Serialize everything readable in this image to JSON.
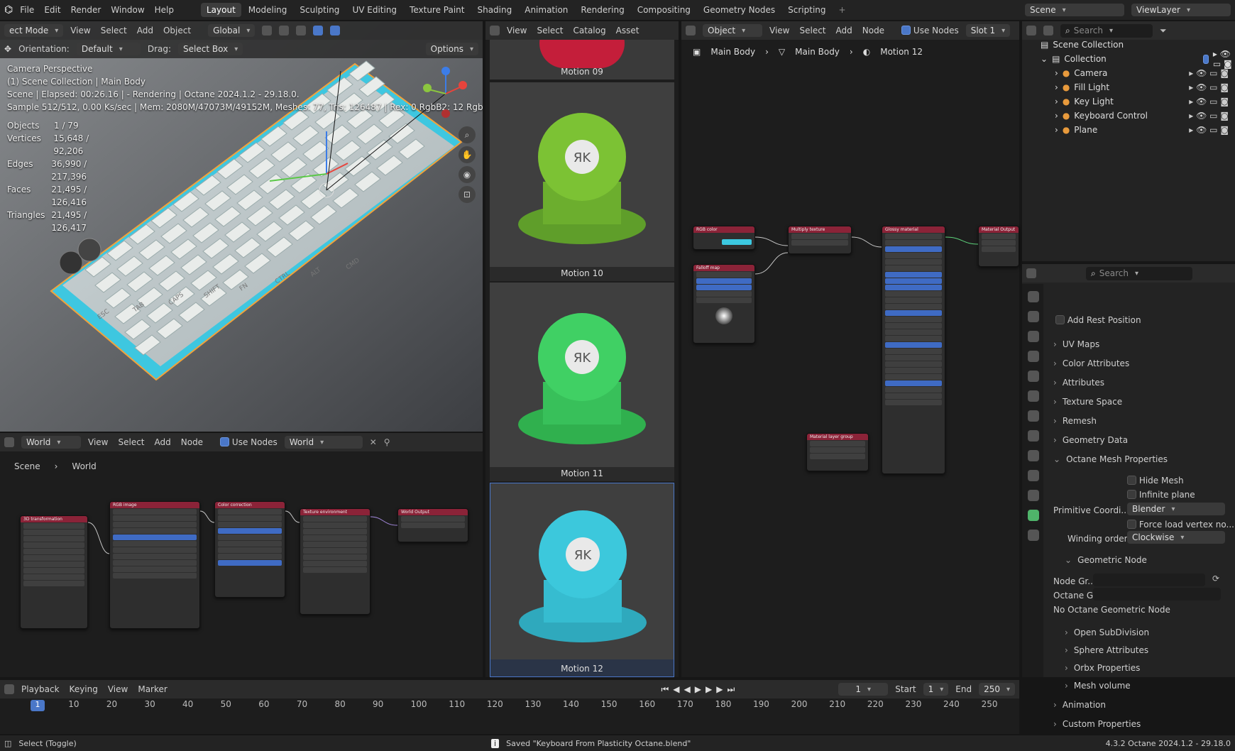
{
  "topbar": {
    "menus": [
      "File",
      "Edit",
      "Render",
      "Window",
      "Help"
    ],
    "workspaces": [
      "Layout",
      "Modeling",
      "Sculpting",
      "UV Editing",
      "Texture Paint",
      "Shading",
      "Animation",
      "Rendering",
      "Compositing",
      "Geometry Nodes",
      "Scripting"
    ],
    "active_workspace": "Layout",
    "scene": "Scene",
    "viewlayer": "ViewLayer"
  },
  "viewport": {
    "mode": "ect Mode",
    "menus": [
      "View",
      "Select",
      "Add",
      "Object"
    ],
    "transform": "Global",
    "orientation_label": "Orientation:",
    "orientation": "Default",
    "drag_label": "Drag:",
    "drag": "Select Box",
    "options": "Options",
    "overlay_lines": [
      "Camera Perspective",
      "(1) Scene Collection | Main Body",
      "Scene | Elapsed: 00:26.16 |  - Rendering | Octane 2024.1.2 - 29.18.0.",
      "Sample 512/512, 0.00 Ks/sec | Mem: 2080M/47073M/49152M, Meshes: 77, Tris: 126487 | Rex: 0 RgbB2: 12 Rgb..."
    ],
    "stats": [
      {
        "k": "Objects",
        "v": "1 / 79"
      },
      {
        "k": "Vertices",
        "v": "15,648 / 92,206"
      },
      {
        "k": "Edges",
        "v": "36,990 / 217,396"
      },
      {
        "k": "Faces",
        "v": "21,495 / 126,416"
      },
      {
        "k": "Triangles",
        "v": "21,495 / 126,417"
      }
    ],
    "keys": [
      "ESC",
      "TAB",
      "CAPS",
      "SHIFT",
      "FN",
      "CTRL",
      "ALT",
      "CMD"
    ]
  },
  "world_editor": {
    "mode": "World",
    "menus": [
      "View",
      "Select",
      "Add",
      "Node"
    ],
    "use_nodes": "Use Nodes",
    "datablock": "World",
    "crumb": [
      "Scene",
      "World"
    ],
    "nodes": [
      "3D transformation",
      "RGB image",
      "Color correction",
      "Texture environment",
      "World Output"
    ]
  },
  "asset_browser": {
    "menus": [
      "View",
      "Select",
      "Catalog",
      "Asset"
    ],
    "items": [
      "Motion 09",
      "Motion 10",
      "Motion 11",
      "Motion 12"
    ],
    "logo": "ЯK"
  },
  "shader_editor": {
    "mode": "Object",
    "menus": [
      "View",
      "Select",
      "Add",
      "Node"
    ],
    "use_nodes": "Use Nodes",
    "slot": "Slot 1",
    "crumb": [
      "Main Body",
      "Main Body",
      "Motion 12"
    ],
    "nodes": [
      "RGB color",
      "Multiply texture",
      "Glossy material",
      "Material Output",
      "Falloff map",
      "Material layer group"
    ]
  },
  "outliner": {
    "search": "Search",
    "root": "Scene Collection",
    "collection": "Collection",
    "items": [
      "Camera",
      "Fill Light",
      "Key Light",
      "Keyboard Control",
      "Plane"
    ]
  },
  "properties": {
    "search": "Search",
    "add_rest": "Add Rest Position",
    "sections": [
      "UV Maps",
      "Color Attributes",
      "Attributes",
      "Texture Space",
      "Remesh",
      "Geometry Data",
      "Octane Mesh Properties"
    ],
    "hide_mesh": "Hide Mesh",
    "infinite_plane": "Infinite plane",
    "prim_label": "Primitive Coordi...",
    "prim_value": "Blender",
    "force_load": "Force load vertex no...",
    "winding_label": "Winding order",
    "winding_value": "Clockwise",
    "geo_node": "Geometric Node",
    "node_gr": "Node Gr...",
    "octane_g": "Octane G...",
    "no_geo": "No Octane Geometric Node",
    "subs": [
      "Open SubDivision",
      "Sphere Attributes",
      "Orbx Properties",
      "Mesh volume"
    ],
    "bottom": [
      "Animation",
      "Custom Properties"
    ]
  },
  "timeline": {
    "menus": [
      "Playback",
      "Keying",
      "View",
      "Marker"
    ],
    "frame": "1",
    "start_label": "Start",
    "start": "1",
    "end_label": "End",
    "end": "250",
    "ticks": [
      "1",
      "10",
      "20",
      "30",
      "40",
      "50",
      "60",
      "70",
      "80",
      "90",
      "100",
      "110",
      "120",
      "130",
      "140",
      "150",
      "160",
      "170",
      "180",
      "190",
      "200",
      "210",
      "220",
      "230",
      "240",
      "250"
    ]
  },
  "status": {
    "left": "Select (Toggle)",
    "center": "Saved \"Keyboard From Plasticity Octane.blend\"",
    "right": "4.3.2   Octane 2024.1.2 - 29.18.0"
  }
}
